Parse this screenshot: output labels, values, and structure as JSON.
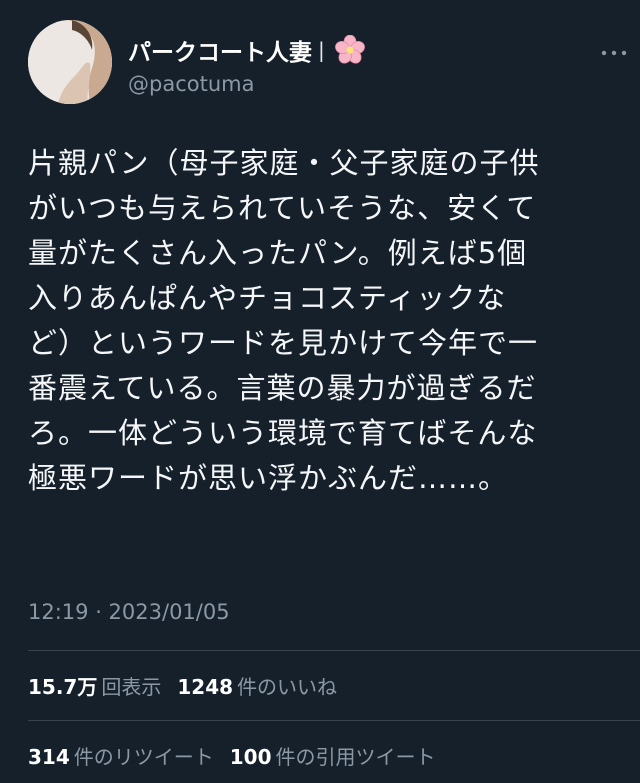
{
  "tweet": {
    "display_name": "パークコート人妻",
    "name_separator": "|",
    "name_emoji": "cherry-blossom-icon",
    "handle": "@pacotuma",
    "text": "片親パン（母子家庭・父子家庭の子供\nがいつも与えられていそうな、安くて\n量がたくさん入ったパン。例えば5個\n入りあんぱんやチョコスティックな\nど）というワードを見かけて今年で一\n番震えている。言葉の暴力が過ぎるだ\nろ。一体どういう環境で育てばそんな\n極悪ワードが思い浮かぶんだ……。",
    "timestamp": "12:19 · 2023/01/05"
  },
  "stats": {
    "views_count": "15.7万",
    "views_label": "回表示",
    "likes_count": "1248",
    "likes_label": "件のいいね",
    "retweets_count": "314",
    "retweets_label": "件のリツイート",
    "quotes_count": "100",
    "quotes_label": "件の引用ツイート"
  },
  "colors": {
    "background": "#15202b",
    "text": "#e7e9ea",
    "secondary_text": "#8b98a5",
    "divider": "#38444d"
  }
}
